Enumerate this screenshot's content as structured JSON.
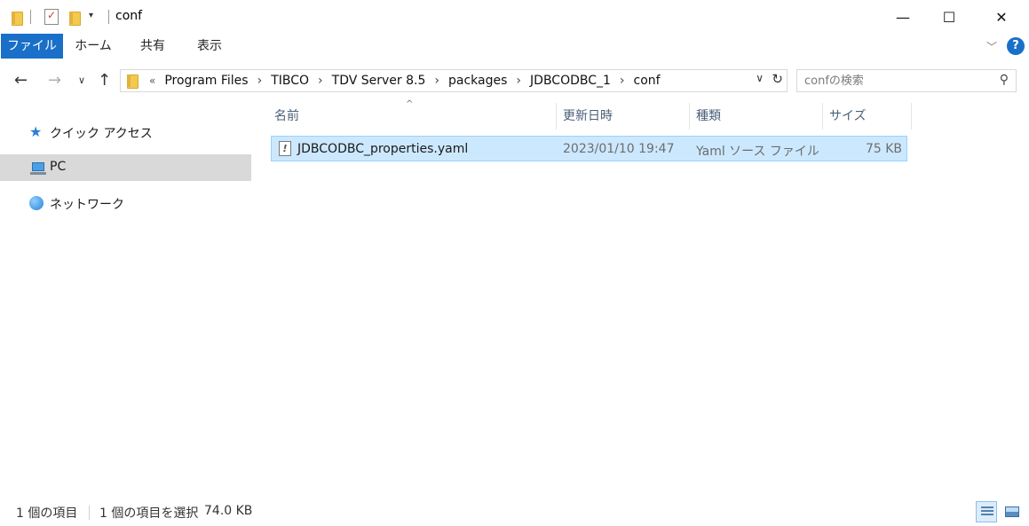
{
  "window": {
    "title": "conf",
    "minimize_glyph": "—",
    "maximize_glyph": "☐",
    "close_glyph": "✕"
  },
  "ribbon": {
    "tabs": [
      {
        "label": "ファイル"
      },
      {
        "label": "ホーム"
      },
      {
        "label": "共有"
      },
      {
        "label": "表示"
      }
    ],
    "help_glyph": "?"
  },
  "address": {
    "lead": "«",
    "breadcrumbs": [
      "Program Files",
      "TIBCO",
      "TDV Server 8.5",
      "packages",
      "JDBCODBC_1",
      "conf"
    ],
    "separator": "›"
  },
  "search": {
    "placeholder": "confの検索"
  },
  "nav_pane": {
    "items": [
      {
        "label": "クイック アクセス",
        "icon": "star-icon"
      },
      {
        "label": "PC",
        "icon": "pc-icon",
        "selected": true
      },
      {
        "label": "ネットワーク",
        "icon": "network-icon"
      }
    ]
  },
  "file_list": {
    "columns": [
      "名前",
      "更新日時",
      "種類",
      "サイズ"
    ],
    "rows": [
      {
        "name": "JDBCODBC_properties.yaml",
        "modified": "2023/01/10 19:47",
        "type": "Yaml ソース ファイル",
        "size": "75 KB",
        "selected": true
      }
    ]
  },
  "status_bar": {
    "item_count": "1 個の項目",
    "selection": "1 個の項目を選択",
    "selection_size": "74.0 KB"
  },
  "colors": {
    "accent": "#1a6fc9",
    "selection_bg": "#cce8ff",
    "selection_border": "#99d1ff",
    "nav_selected_bg": "#d9d9d9"
  }
}
